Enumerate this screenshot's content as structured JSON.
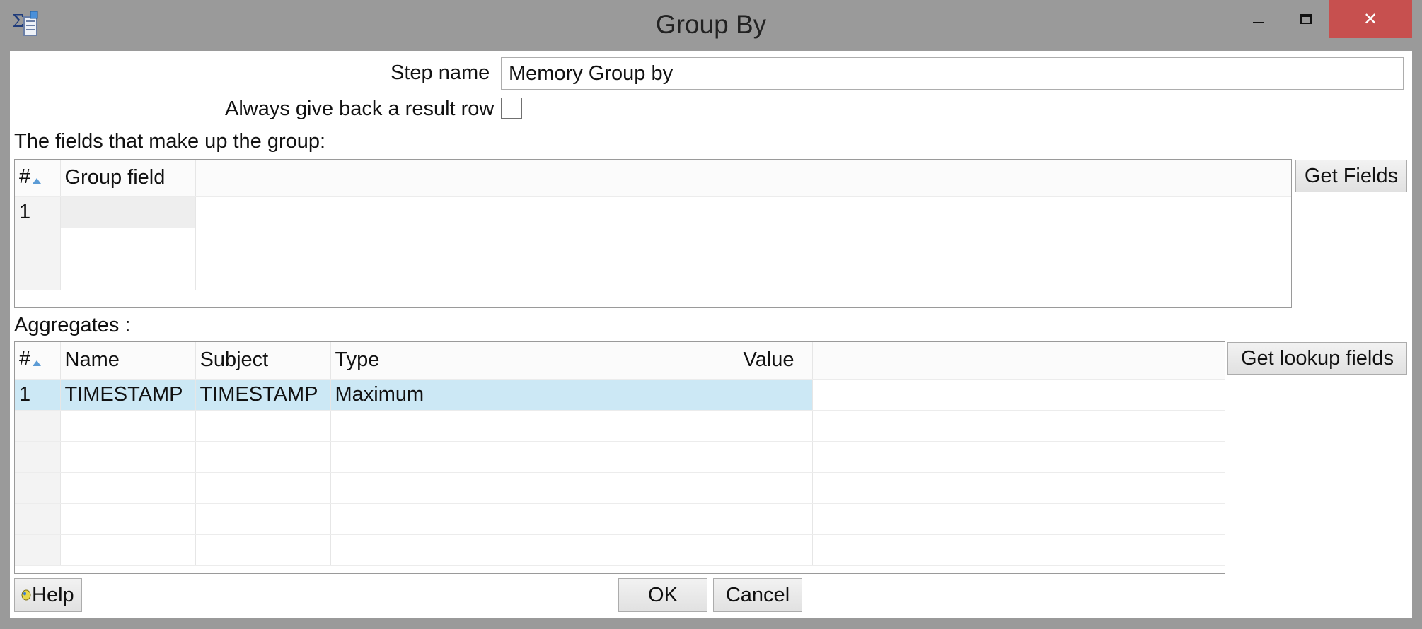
{
  "window": {
    "title": "Group By",
    "close_glyph": "✕"
  },
  "form": {
    "step_name_label": "Step name",
    "step_name_value": "Memory Group by",
    "always_result_label": "Always give back a result row",
    "always_result_checked": false
  },
  "group_section": {
    "label": "The fields that make up the group:",
    "columns": [
      "#",
      "Group field"
    ],
    "rows": [
      [
        "1",
        ""
      ],
      [
        "",
        ""
      ],
      [
        "",
        ""
      ]
    ],
    "get_fields_label": "Get Fields"
  },
  "aggregates_section": {
    "label": "Aggregates :",
    "columns": [
      "#",
      "Name",
      "Subject",
      "Type",
      "Value"
    ],
    "rows": [
      [
        "1",
        "TIMESTAMP",
        "TIMESTAMP",
        "Maximum",
        ""
      ],
      [
        "",
        "",
        "",
        "",
        ""
      ],
      [
        "",
        "",
        "",
        "",
        ""
      ],
      [
        "",
        "",
        "",
        "",
        ""
      ],
      [
        "",
        "",
        "",
        "",
        ""
      ],
      [
        "",
        "",
        "",
        "",
        ""
      ]
    ],
    "get_lookup_fields_label": "Get lookup fields"
  },
  "footer": {
    "help_label": "Help",
    "ok_label": "OK",
    "cancel_label": "Cancel"
  },
  "icons": {
    "app": "group-by-sigma-icon",
    "minimize": "minimize-icon",
    "maximize": "maximize-icon",
    "close": "close-icon",
    "help": "help-icon",
    "sort": "sort-ascending-icon"
  },
  "colors": {
    "close_button": "#c7504f",
    "selected_row": "#cce8f5",
    "window_frame": "#9a9a9a"
  }
}
